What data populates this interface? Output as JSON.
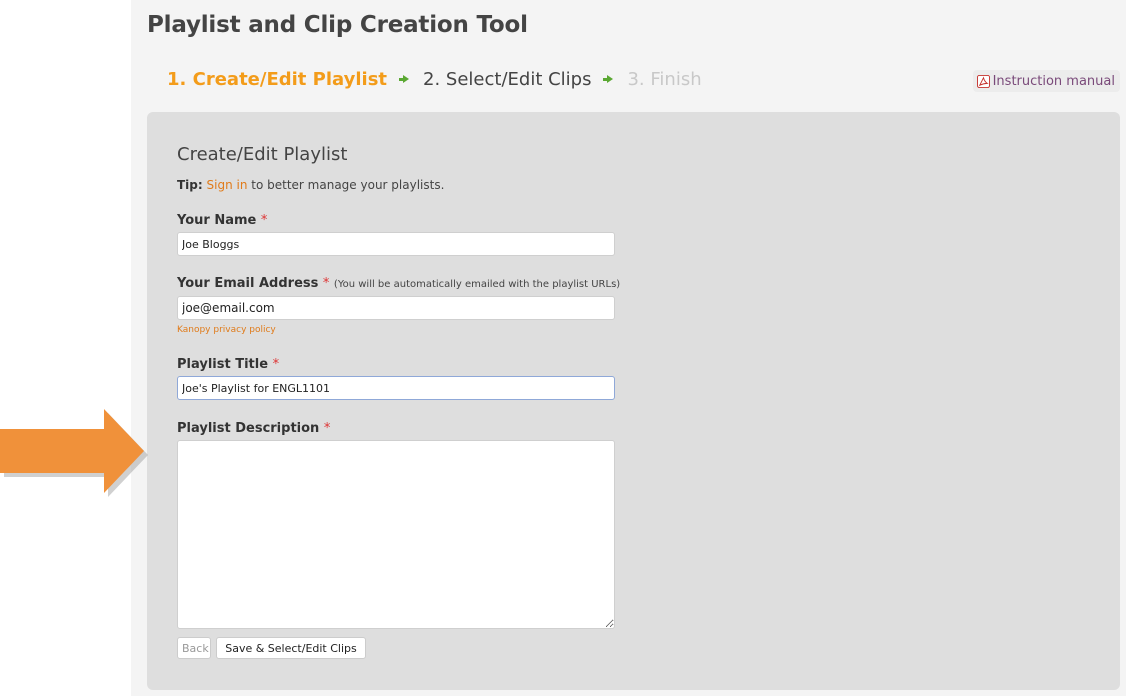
{
  "app": {
    "title": "Playlist and Clip Creation Tool"
  },
  "steps": [
    {
      "label": "1. Create/Edit Playlist",
      "state": "active"
    },
    {
      "label": "2. Select/Edit Clips",
      "state": "upcoming"
    },
    {
      "label": "3. Finish",
      "state": "disabled"
    }
  ],
  "manual": {
    "label": "Instruction manual",
    "icon": "pdf-icon"
  },
  "form": {
    "heading": "Create/Edit Playlist",
    "tip": {
      "prefix": "Tip:",
      "link": "Sign in",
      "suffix": "to better manage your playlists."
    },
    "required_mark": "*",
    "name": {
      "label": "Your Name",
      "value": "Joe Bloggs"
    },
    "email": {
      "label": "Your Email Address",
      "note": "(You will be automatically emailed with the playlist URLs)",
      "value": "joe@email.com",
      "privacy_link": "Kanopy privacy policy"
    },
    "title": {
      "label": "Playlist Title",
      "value": "Joe's Playlist for ENGL1101"
    },
    "description": {
      "label": "Playlist Description",
      "value": ""
    },
    "buttons": {
      "back": "Back",
      "save": "Save & Select/Edit Clips"
    }
  },
  "colors": {
    "accent": "#f39c1a",
    "link": "#e07b1a",
    "panel": "#dedede",
    "callout_arrow": "#f0913a"
  }
}
